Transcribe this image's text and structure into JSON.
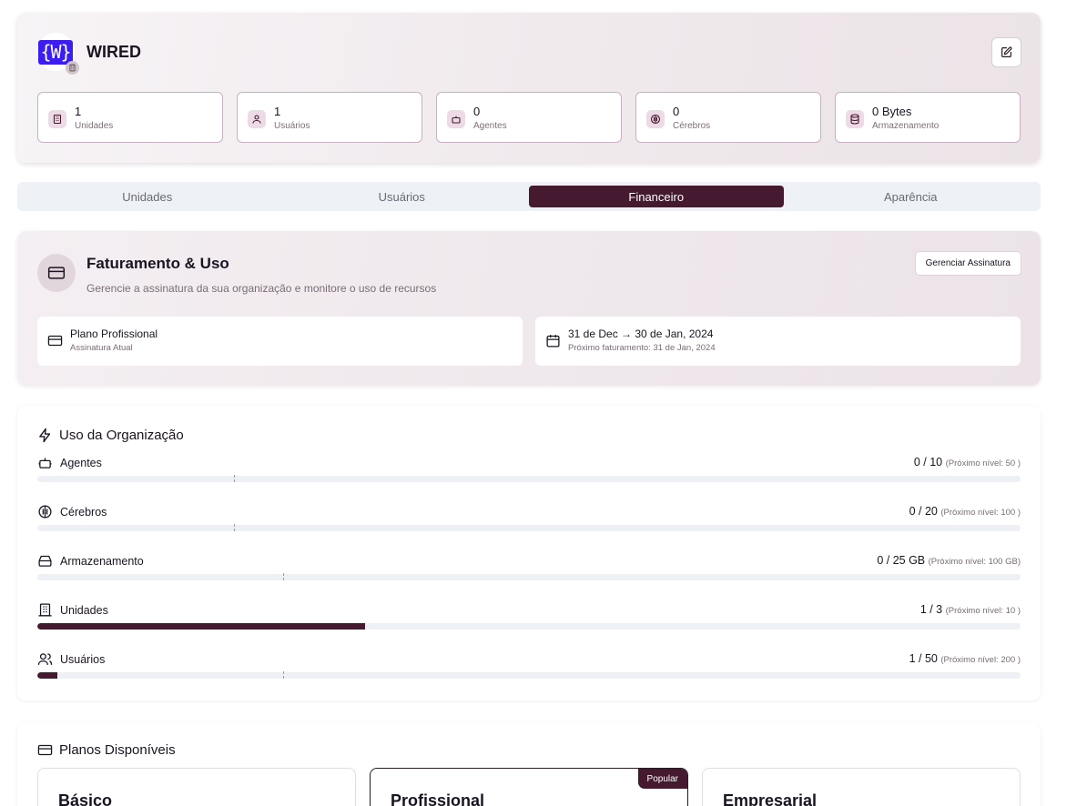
{
  "colors": {
    "accent": "#451a30",
    "logo_bg": "#3b1df2",
    "track": "#edf1f6",
    "stat_border": "#c9b1c3"
  },
  "org": {
    "logo_text": "{W}",
    "name": "WIRED",
    "edit_icon": "edit-icon",
    "stats": [
      {
        "icon": "building-icon",
        "value": "1",
        "label": "Unidades"
      },
      {
        "icon": "user-icon",
        "value": "1",
        "label": "Usuários"
      },
      {
        "icon": "bot-icon",
        "value": "0",
        "label": "Agentes"
      },
      {
        "icon": "brain-icon",
        "value": "0",
        "label": "Cérebros"
      },
      {
        "icon": "database-icon",
        "value": "0 Bytes",
        "label": "Armazenamento"
      }
    ]
  },
  "tabs": [
    {
      "label": "Unidades",
      "active": false
    },
    {
      "label": "Usuários",
      "active": false
    },
    {
      "label": "Financeiro",
      "active": true
    },
    {
      "label": "Aparência",
      "active": false
    }
  ],
  "billing": {
    "title": "Faturamento & Uso",
    "subtitle": "Gerencie a assinatura da sua organização e monitore o uso de recursos",
    "manage_label": "Gerenciar Assinatura",
    "plan": {
      "name": "Plano Profissional",
      "caption": "Assinatura Atual"
    },
    "period": {
      "range": "31 de Dec → 30 de Jan, 2024",
      "next": "Próximo faturamento: 31 de Jan, 2024"
    }
  },
  "usage": {
    "title": "Uso da Organização",
    "rows": [
      {
        "icon": "bot-icon",
        "label": "Agentes",
        "count": "0 / 10",
        "next": "(Próximo nível: 50 )",
        "progress": 0.0
      },
      {
        "icon": "brain-icon",
        "label": "Cérebros",
        "count": "0 / 20",
        "next": "(Próximo nível: 100 )",
        "progress": 0.0
      },
      {
        "icon": "hard-drive-icon",
        "label": "Armazenamento",
        "count": "0 / 25 GB",
        "next": "(Próximo nível: 100 GB)",
        "progress": 0.0
      },
      {
        "icon": "building-icon",
        "label": "Unidades",
        "count": "1 / 3",
        "next": "(Próximo nível: 10 )",
        "progress": 0.333
      },
      {
        "icon": "users-icon",
        "label": "Usuários",
        "count": "1 / 50",
        "next": "(Próximo nível: 200 )",
        "progress": 0.02
      }
    ]
  },
  "plans": {
    "title": "Planos Disponíveis",
    "items": [
      {
        "name": "Básico",
        "badge": ""
      },
      {
        "name": "Profissional",
        "badge": "Popular"
      },
      {
        "name": "Empresarial",
        "badge": ""
      }
    ]
  }
}
